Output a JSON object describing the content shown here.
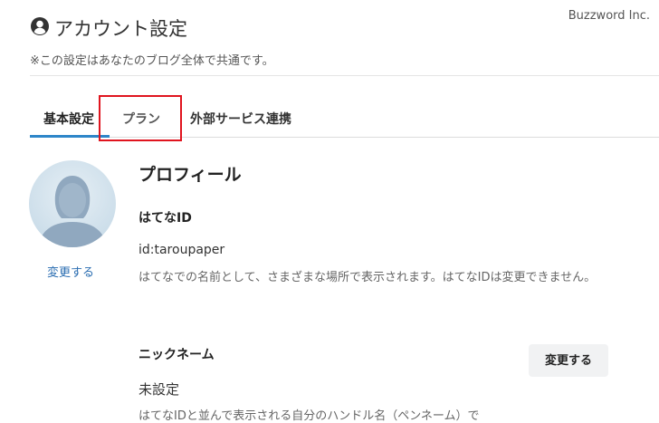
{
  "watermark": "Buzzword Inc.",
  "header": {
    "title": "アカウント設定",
    "subtitle": "※この設定はあなたのブログ全体で共通です。",
    "icon": "user-circle-icon"
  },
  "tabs": [
    {
      "label": "基本設定",
      "active": true
    },
    {
      "label": "プラン",
      "active": false
    },
    {
      "label": "外部サービス連携",
      "active": false
    }
  ],
  "colors": {
    "accent": "#2e86c9",
    "highlight": "#e0141e",
    "link": "#2a6db1",
    "avatar_bg": "#c8dbe8",
    "avatar_figure": "#90a8bf"
  },
  "avatar": {
    "change_label": "変更する",
    "icon": "default-avatar-icon"
  },
  "profile": {
    "section_title": "プロフィール",
    "hatena_id": {
      "label": "はてなID",
      "value": "id:taroupaper",
      "description": "はてなでの名前として、さまざまな場所で表示されます。はてなIDは変更できません。"
    },
    "nickname": {
      "label": "ニックネーム",
      "value": "未設定",
      "change_button": "変更する",
      "description": "はてなIDと並んで表示される自分のハンドル名（ペンネーム）で"
    }
  }
}
